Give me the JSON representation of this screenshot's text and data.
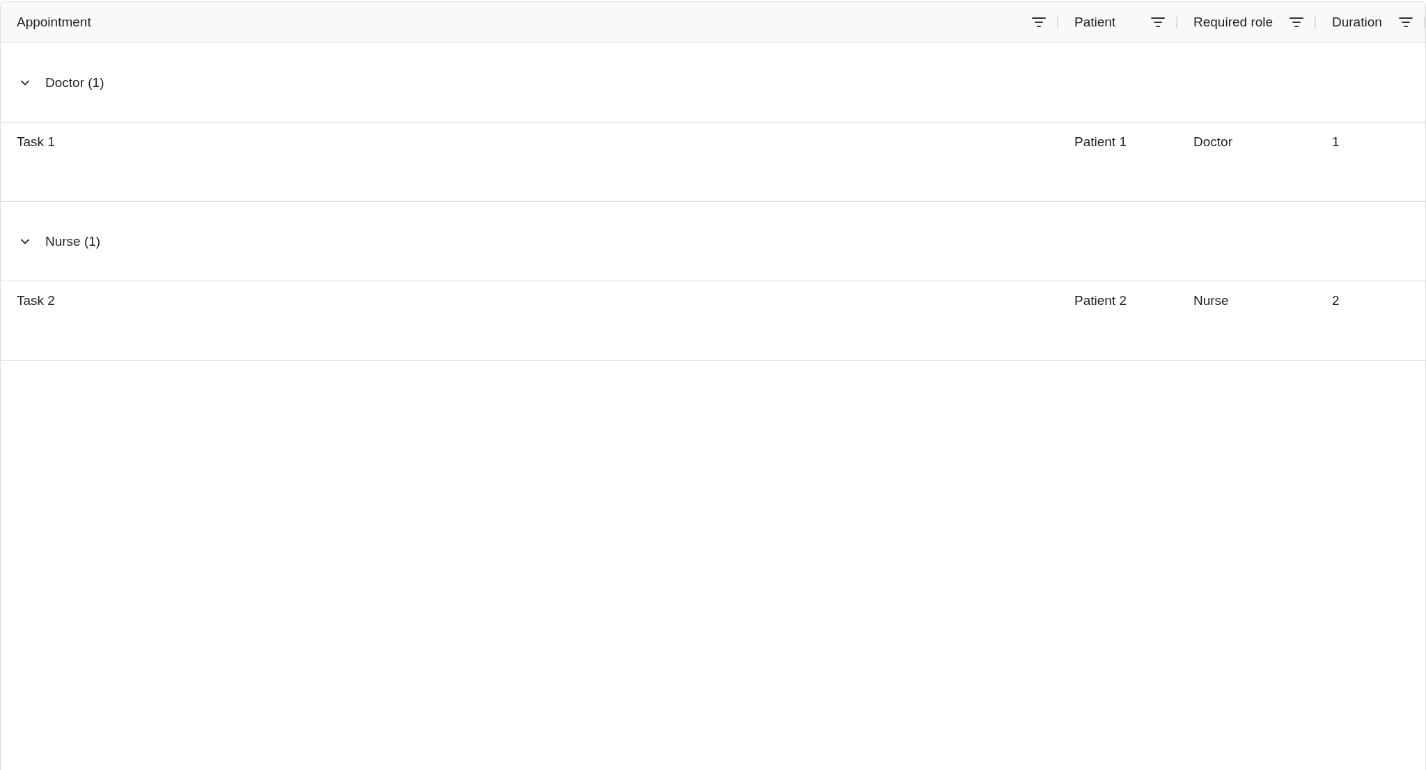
{
  "table": {
    "columns": [
      {
        "label": "Appointment"
      },
      {
        "label": "Patient"
      },
      {
        "label": "Required role"
      },
      {
        "label": "Duration"
      }
    ],
    "groups": [
      {
        "label": "Doctor (1)",
        "expanded": true,
        "rows": [
          {
            "cells": [
              "Task 1",
              "Patient 1",
              "Doctor",
              "1"
            ]
          }
        ]
      },
      {
        "label": "Nurse (1)",
        "expanded": true,
        "rows": [
          {
            "cells": [
              "Task 2",
              "Patient 2",
              "Nurse",
              "2"
            ]
          }
        ]
      }
    ]
  }
}
